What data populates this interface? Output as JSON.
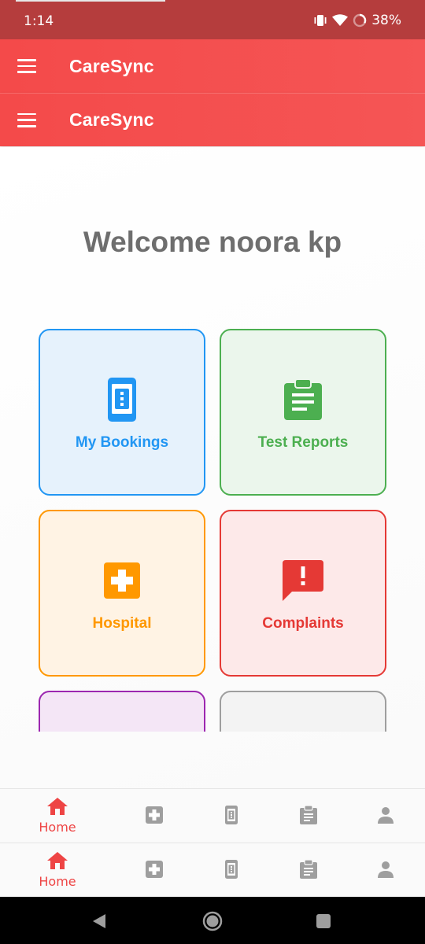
{
  "status_bar": {
    "time": "1:14",
    "battery": "38%"
  },
  "app_bars": [
    {
      "title": "CareSync"
    },
    {
      "title": "CareSync"
    }
  ],
  "welcome": "Welcome noora kp",
  "cards": [
    {
      "label": "My Bookings",
      "icon": "booking-phone-icon",
      "color": "#2196f3",
      "bg": "#e6f2fc"
    },
    {
      "label": "Test Reports",
      "icon": "clipboard-icon",
      "color": "#4caf50",
      "bg": "#ebf6ec"
    },
    {
      "label": "Hospital",
      "icon": "hospital-plus-icon",
      "color": "#ff9800",
      "bg": "#fff3e4"
    },
    {
      "label": "Complaints",
      "icon": "feedback-alert-icon",
      "color": "#e53935",
      "bg": "#fde9e9"
    },
    {
      "label": "",
      "icon": "",
      "color": "#9c27b0",
      "bg": "#f4e6f6"
    },
    {
      "label": "",
      "icon": "",
      "color": "#9e9e9e",
      "bg": "#f3f3f3"
    }
  ],
  "bottom_nav": {
    "active_color": "#ee4444",
    "inactive_color": "#9e9e9e",
    "home_label": "Home",
    "items": [
      "home-icon",
      "hospital-plus-icon",
      "booking-phone-icon",
      "clipboard-icon",
      "person-icon"
    ]
  }
}
